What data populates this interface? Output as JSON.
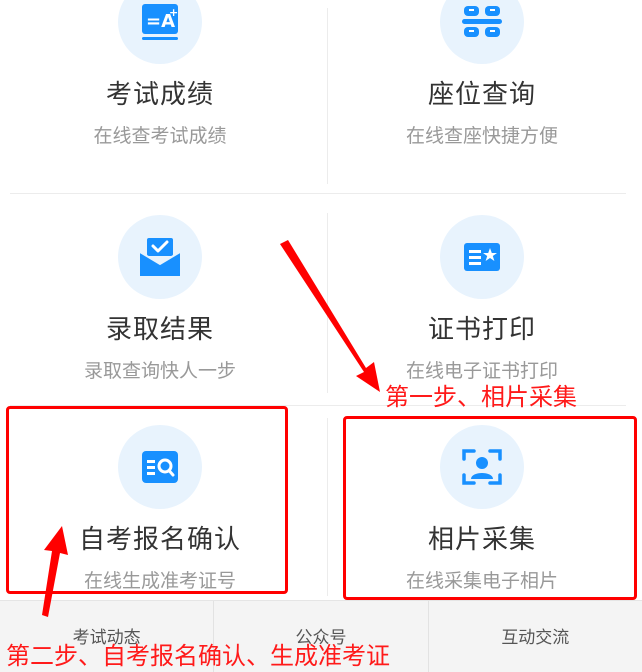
{
  "tiles": [
    {
      "title": "考试成绩",
      "subtitle": "在线查考试成绩",
      "icon": "grade-icon"
    },
    {
      "title": "座位查询",
      "subtitle": "在线查座快捷方便",
      "icon": "seat-icon"
    },
    {
      "title": "录取结果",
      "subtitle": "录取查询快人一步",
      "icon": "envelope-check-icon"
    },
    {
      "title": "证书打印",
      "subtitle": "在线电子证书打印",
      "icon": "certificate-icon"
    },
    {
      "title": "自考报名确认",
      "subtitle": "在线生成准考证号",
      "icon": "search-list-icon"
    },
    {
      "title": "相片采集",
      "subtitle": "在线采集电子相片",
      "icon": "photo-capture-icon"
    }
  ],
  "bottom_tabs": [
    "考试动态",
    "公众号",
    "互动交流"
  ],
  "annotations": {
    "step1": "第一步、相片采集",
    "step2": "第二步、自考报名确认、生成准考证"
  },
  "colors": {
    "accent": "#1890ff",
    "icon_bg": "#e8f3fd",
    "annotation": "#ff0000"
  }
}
